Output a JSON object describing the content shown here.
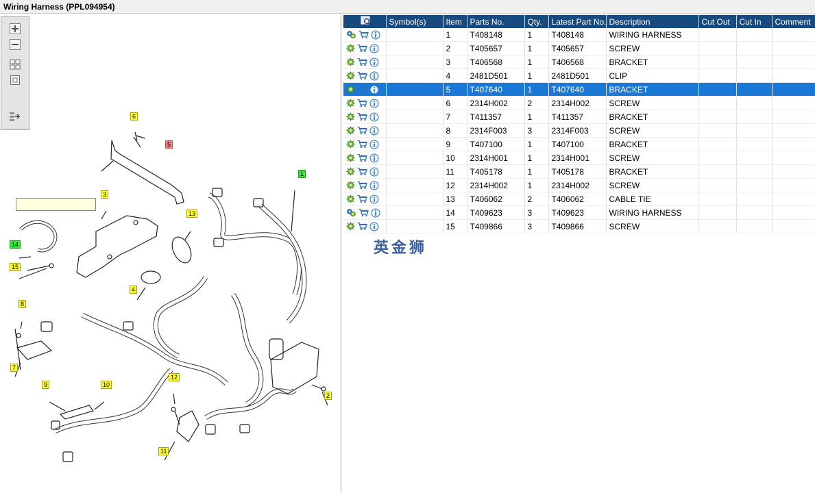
{
  "window": {
    "title": "Wiring Harness (PPL094954)"
  },
  "toolbar": {
    "tools": [
      {
        "name": "zoom-in-icon"
      },
      {
        "name": "zoom-out-icon"
      },
      {
        "name": "fit-all-icon"
      },
      {
        "name": "fit-page-icon"
      },
      {
        "name": "export-icon"
      }
    ]
  },
  "diagram": {
    "callouts": [
      {
        "label": "6",
        "style": "yellow"
      },
      {
        "label": "5",
        "style": "red"
      },
      {
        "label": "1",
        "style": "green"
      },
      {
        "label": "3",
        "style": "yellow"
      },
      {
        "label": "13",
        "style": "yellow"
      },
      {
        "label": "14",
        "style": "green"
      },
      {
        "label": "15",
        "style": "yellow"
      },
      {
        "label": "4",
        "style": "yellow"
      },
      {
        "label": "8",
        "style": "yellow"
      },
      {
        "label": "7",
        "style": "yellow"
      },
      {
        "label": "9",
        "style": "yellow"
      },
      {
        "label": "10",
        "style": "yellow"
      },
      {
        "label": "12",
        "style": "yellow"
      },
      {
        "label": "2",
        "style": "yellow"
      },
      {
        "label": "11",
        "style": "yellow"
      }
    ]
  },
  "table": {
    "headers": [
      "",
      "Symbol(s)",
      "Item",
      "Parts No.",
      "Qty.",
      "Latest Part No.",
      "Description",
      "Cut Out",
      "Cut In",
      "Comment"
    ],
    "rows": [
      {
        "item": "1",
        "part": "T408148",
        "qty": "1",
        "latest": "T408148",
        "desc": "WIRING HARNESS",
        "gear": "multi"
      },
      {
        "item": "2",
        "part": "T405657",
        "qty": "1",
        "latest": "T405657",
        "desc": "SCREW",
        "gear": "single"
      },
      {
        "item": "3",
        "part": "T406568",
        "qty": "1",
        "latest": "T406568",
        "desc": "BRACKET",
        "gear": "single"
      },
      {
        "item": "4",
        "part": "2481D501",
        "qty": "1",
        "latest": "2481D501",
        "desc": "CLIP",
        "gear": "single"
      },
      {
        "item": "5",
        "part": "T407640",
        "qty": "1",
        "latest": "T407640",
        "desc": "BRACKET",
        "gear": "single",
        "selected": true
      },
      {
        "item": "6",
        "part": "2314H002",
        "qty": "2",
        "latest": "2314H002",
        "desc": "SCREW",
        "gear": "single"
      },
      {
        "item": "7",
        "part": "T411357",
        "qty": "1",
        "latest": "T411357",
        "desc": "BRACKET",
        "gear": "single"
      },
      {
        "item": "8",
        "part": "2314F003",
        "qty": "3",
        "latest": "2314F003",
        "desc": "SCREW",
        "gear": "single"
      },
      {
        "item": "9",
        "part": "T407100",
        "qty": "1",
        "latest": "T407100",
        "desc": "BRACKET",
        "gear": "single"
      },
      {
        "item": "10",
        "part": "2314H001",
        "qty": "1",
        "latest": "2314H001",
        "desc": "SCREW",
        "gear": "single"
      },
      {
        "item": "11",
        "part": "T405178",
        "qty": "1",
        "latest": "T405178",
        "desc": "BRACKET",
        "gear": "single"
      },
      {
        "item": "12",
        "part": "2314H002",
        "qty": "1",
        "latest": "2314H002",
        "desc": "SCREW",
        "gear": "single"
      },
      {
        "item": "13",
        "part": "T406062",
        "qty": "2",
        "latest": "T406062",
        "desc": "CABLE TIE",
        "gear": "single"
      },
      {
        "item": "14",
        "part": "T409623",
        "qty": "3",
        "latest": "T409623",
        "desc": "WIRING HARNESS",
        "gear": "multi"
      },
      {
        "item": "15",
        "part": "T409866",
        "qty": "3",
        "latest": "T409866",
        "desc": "SCREW",
        "gear": "single"
      }
    ]
  },
  "watermark": {
    "text": "英金狮"
  },
  "colors": {
    "header_bg": "#174a7e",
    "selected_row": "#1a78d6",
    "callout_yellow": "#ffff33",
    "callout_red": "#f08080",
    "callout_green": "#33ee33"
  }
}
